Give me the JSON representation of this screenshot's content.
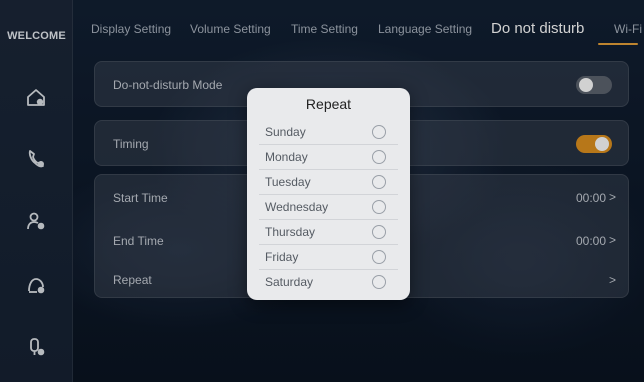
{
  "sidebar": {
    "welcome": "WELCOME",
    "icons": [
      "home-icon",
      "phone-icon",
      "user-settings-icon",
      "user-check-icon",
      "user-wifi-icon"
    ]
  },
  "tabs": {
    "items": [
      {
        "label": "Display Setting"
      },
      {
        "label": "Volume Setting"
      },
      {
        "label": "Time Setting"
      },
      {
        "label": "Language Setting"
      },
      {
        "label": "Do not disturb"
      },
      {
        "label": "Wi-Fi"
      }
    ],
    "active_index": 4
  },
  "settings": {
    "dnd_mode_label": "Do-not-disturb Mode",
    "dnd_mode_on": false,
    "timing_label": "Timing",
    "timing_on": true,
    "start_time_label": "Start Time",
    "start_time_value": "00:00",
    "end_time_label": "End Time",
    "end_time_value": "00:00",
    "repeat_label": "Repeat",
    "chevron": ">"
  },
  "repeat_popup": {
    "title": "Repeat",
    "days": [
      {
        "label": "Sunday",
        "checked": false
      },
      {
        "label": "Monday",
        "checked": false
      },
      {
        "label": "Tuesday",
        "checked": false
      },
      {
        "label": "Wednesday",
        "checked": false
      },
      {
        "label": "Thursday",
        "checked": false
      },
      {
        "label": "Friday",
        "checked": false
      },
      {
        "label": "Saturday",
        "checked": false
      }
    ]
  },
  "colors": {
    "accent": "#e0921f",
    "toggle_off": "#5d6470",
    "popup_bg": "#e9eaec"
  }
}
